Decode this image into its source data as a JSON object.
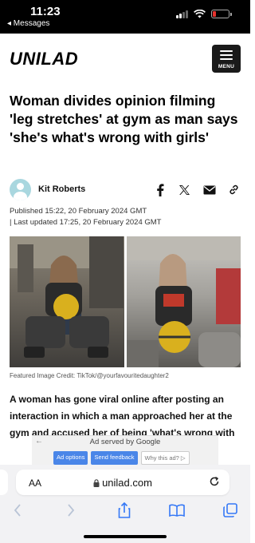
{
  "status_bar": {
    "time": "11:23",
    "back_app": "◂ Messages"
  },
  "header": {
    "logo": "UNILAD",
    "menu_label": "MENU"
  },
  "article": {
    "headline": "Woman divides opinion filming 'leg stretches' at gym as man says 'she's what's wrong with girls'",
    "author": "Kit Roberts",
    "published": "Published 15:22, 20 February 2024 GMT",
    "updated": "| Last updated 17:25, 20 February 2024 GMT",
    "image_credit": "Featured Image Credit: TikTok/@yourfavouritedaughter2",
    "body": "A woman has gone viral online after posting an interaction in which a man approached her at the gym and accused her of being 'what's wrong with"
  },
  "share": {
    "icons": [
      "facebook-icon",
      "x-twitter-icon",
      "email-icon",
      "link-icon"
    ]
  },
  "ad": {
    "served_by": "Ad served by Google",
    "options": "Ad options",
    "feedback": "Send feedback",
    "why": "Why this ad? ▷"
  },
  "browser": {
    "aa_label": "AA",
    "url": "unilad.com"
  },
  "colors": {
    "status_bar": "#000000",
    "menu_button": "#1a1a1a",
    "ad_button": "#4a86e8",
    "battery_low": "#e5322d",
    "safari_icon": "#3478f6"
  }
}
